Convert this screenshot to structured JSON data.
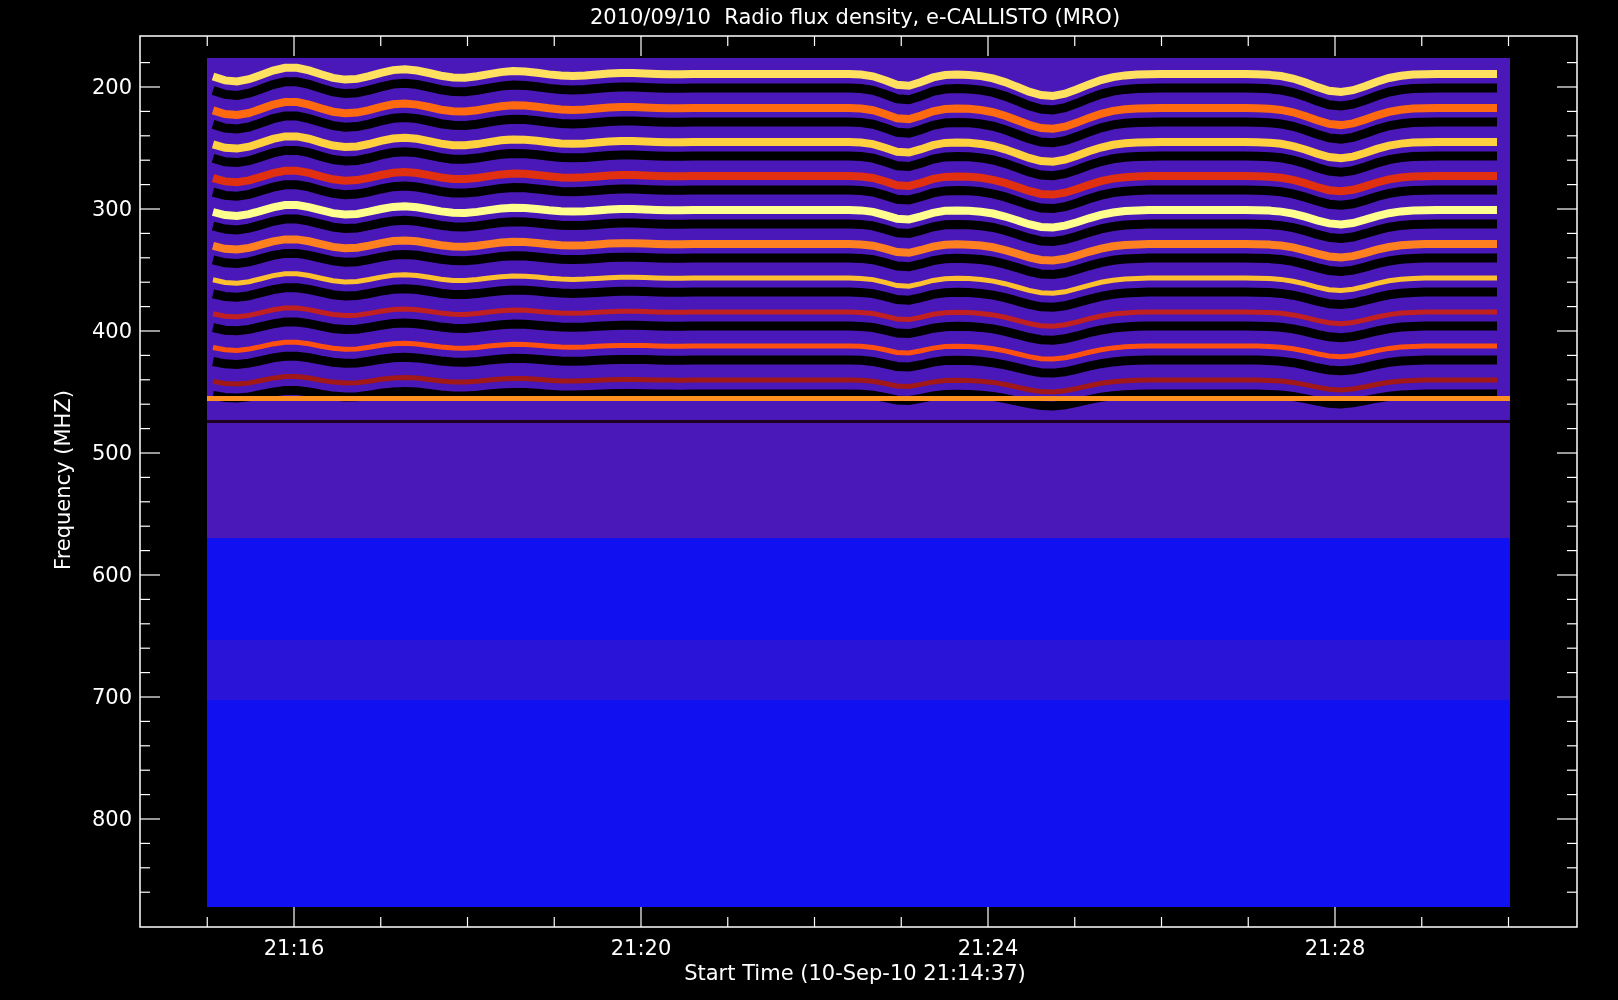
{
  "title": "2010/09/10  Radio flux density, e-CALLISTO (MRO)",
  "y_axis": {
    "label": "Frequency (MHZ)",
    "ticks": [
      "200",
      "300",
      "400",
      "500",
      "600",
      "700",
      "800"
    ]
  },
  "x_axis": {
    "label": "Start Time (10-Sep-10 21:14:37)",
    "ticks": [
      "21:16",
      "21:20",
      "21:24",
      "21:28"
    ]
  }
}
